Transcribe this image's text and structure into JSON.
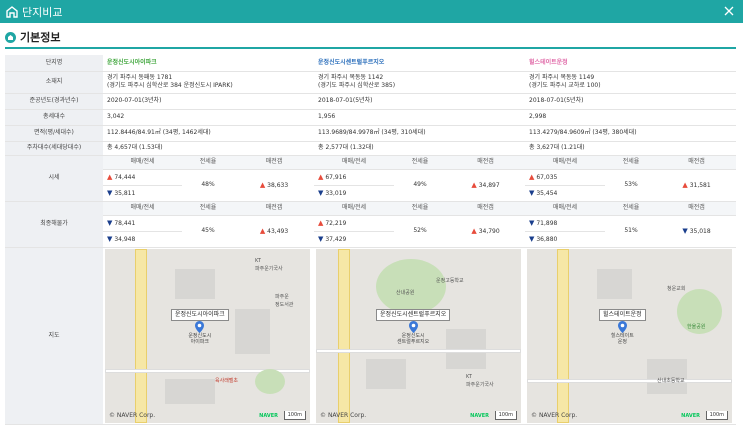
{
  "window": {
    "title": "단지비교"
  },
  "section": {
    "title": "기본정보"
  },
  "labels": {
    "name": "단지명",
    "address": "소재지",
    "completion": "준공년도(경과년수)",
    "households": "총세대수",
    "area": "면적(평/세대수)",
    "parking": "주차대수(세대당대수)",
    "price": "시세",
    "recent": "최종해물가",
    "map": "지도"
  },
  "sub_headers": {
    "sale": "매매/전세",
    "ratio": "전세율",
    "gap": "매전갭"
  },
  "colors": {
    "accent": "#1fa6a4",
    "up": "#e74c3c",
    "down": "#1a3e8c"
  },
  "complexes": [
    {
      "name": "운정신도시아이파크",
      "address1": "경기 파주시 동패동 1781",
      "address2": "(경기도 파주시 심학산로 384 운정신도시 IPARK)",
      "completion": "2020-07-01(3년차)",
      "households": "3,042",
      "area": "112.8446/84.91㎡ (34평, 1462세대)",
      "parking": "총 4,657대 (1.53대)",
      "price": {
        "sale": "74,444",
        "jeonse": "35,811",
        "ratio": "48%",
        "gap": "38,633",
        "gap_dir": "up"
      },
      "recent": {
        "sale": "78,441",
        "jeonse": "34,948",
        "ratio": "45%",
        "gap": "43,493",
        "gap_dir": "up"
      },
      "map": {
        "label": "운정신도시아이파크",
        "sub": "운정신도시\n아이파크",
        "copyright": "© NAVER Corp.",
        "brand": "NAVER",
        "scale": "100m",
        "poi1": "KT\n파주운기국사",
        "poi2": "파주운\n정도서관",
        "poi3": "육사래벨초"
      }
    },
    {
      "name": "운정신도시센트럴푸르지오",
      "address1": "경기 파주시 목동동 1142",
      "address2": "(경기도 파주시 심학산로 385)",
      "completion": "2018-07-01(5년차)",
      "households": "1,956",
      "area": "113.9689/84.9978㎡ (34평, 310세대)",
      "parking": "총 2,577대 (1.32대)",
      "price": {
        "sale": "67,916",
        "jeonse": "33,019",
        "ratio": "49%",
        "gap": "34,897",
        "gap_dir": "up"
      },
      "recent": {
        "sale": "72,219",
        "jeonse": "37,429",
        "ratio": "52%",
        "gap": "34,790",
        "gap_dir": "up"
      },
      "map": {
        "label": "운정신도시센트럴푸르지오",
        "sub": "운정신도시\n센트럴푸르지오",
        "copyright": "© NAVER Corp.",
        "brand": "NAVER",
        "scale": "100m",
        "poi1": "산내공원",
        "poi2": "운정고등학교",
        "poi3": "KT\n파주운기국사"
      }
    },
    {
      "name": "힐스테이트운정",
      "address1": "경기 파주시 목동동 1149",
      "address2": "(경기도 파주시 교하로 100)",
      "completion": "2018-07-01(5년차)",
      "households": "2,998",
      "area": "113.4279/84.9609㎡ (34평, 380세대)",
      "parking": "총 3,627대 (1.21대)",
      "price": {
        "sale": "67,035",
        "jeonse": "35,454",
        "ratio": "53%",
        "gap": "31,581",
        "gap_dir": "up"
      },
      "recent": {
        "sale": "71,898",
        "jeonse": "36,880",
        "ratio": "51%",
        "gap": "35,018",
        "gap_dir": "down"
      },
      "map": {
        "label": "힐스테이트운정",
        "sub": "힐스테이트\n운정",
        "copyright": "© NAVER Corp.",
        "brand": "NAVER",
        "scale": "100m",
        "poi1": "청운교회",
        "poi2": "한울공원",
        "poi3": "산내초등학교"
      }
    }
  ]
}
